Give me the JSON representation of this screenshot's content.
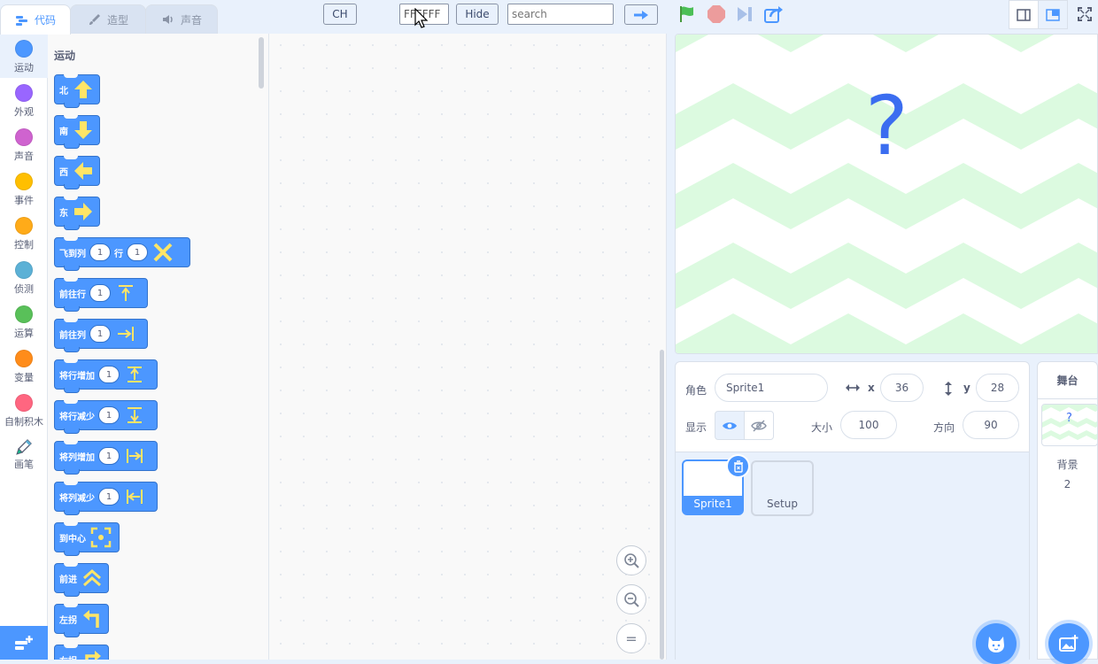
{
  "tabs": [
    {
      "label": "代码",
      "icon": "code-icon"
    },
    {
      "label": "造型",
      "icon": "brush-icon"
    },
    {
      "label": "声音",
      "icon": "speaker-icon"
    }
  ],
  "toolbar": {
    "lang_button": "CH",
    "color_input_value": "FFFFFF",
    "hide_button": "Hide",
    "search_placeholder": "search"
  },
  "categories": [
    {
      "label": "运动",
      "color": "#4c97ff"
    },
    {
      "label": "外观",
      "color": "#9966ff"
    },
    {
      "label": "声音",
      "color": "#cf63cf"
    },
    {
      "label": "事件",
      "color": "#ffbf00"
    },
    {
      "label": "控制",
      "color": "#ffab19"
    },
    {
      "label": "侦测",
      "color": "#5cb1d6"
    },
    {
      "label": "运算",
      "color": "#59c059"
    },
    {
      "label": "变量",
      "color": "#ff8c1a"
    },
    {
      "label": "自制积木",
      "color": "#ff6680"
    },
    {
      "label": "画笔",
      "color": ""
    }
  ],
  "palette": {
    "title": "运动",
    "blocks": {
      "north": "北",
      "south": "南",
      "west": "西",
      "east": "东",
      "fly_to_col": "飞到列",
      "fly_row": "行",
      "goto_row": "前往行",
      "goto_col": "前往列",
      "row_inc": "将行增加",
      "row_dec": "将行减少",
      "col_inc": "将列增加",
      "col_dec": "将列减少",
      "to_center": "到中心",
      "forward": "前进",
      "turn_left": "左拐",
      "turn_right": "右拐",
      "default_value": "1"
    }
  },
  "zoom": {
    "reset_label": "="
  },
  "stage": {
    "placeholder": "?"
  },
  "sprite_info": {
    "sprite_label": "角色",
    "sprite_name": "Sprite1",
    "x_label": "x",
    "x_value": "36",
    "y_label": "y",
    "y_value": "28",
    "show_label": "显示",
    "size_label": "大小",
    "size_value": "100",
    "direction_label": "方向",
    "direction_value": "90"
  },
  "sprites": [
    {
      "name": "Sprite1",
      "selected": true
    },
    {
      "name": "Setup",
      "selected": false
    }
  ],
  "stage_panel": {
    "title": "舞台",
    "backdrop_label": "背景",
    "backdrop_count": "2",
    "thumb_text": "?"
  },
  "colors": {
    "accent": "#4c97ff",
    "stage_pattern": "#dcfae0"
  }
}
